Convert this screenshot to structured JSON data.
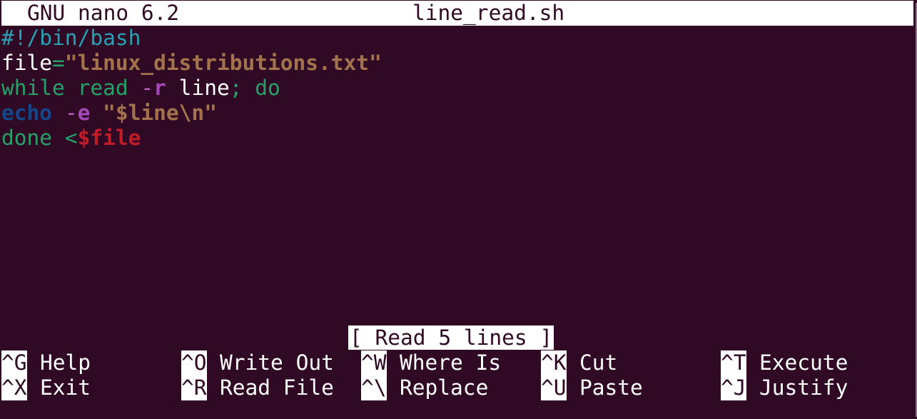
{
  "header": {
    "app_name": "GNU nano 6.2",
    "file_name": "line_read.sh"
  },
  "editor": {
    "lines": [
      {
        "tokens": [
          {
            "text": "#!/bin/bash",
            "kind": "comment"
          }
        ]
      },
      {
        "tokens": [
          {
            "text": "file",
            "kind": "var"
          },
          {
            "text": "=",
            "kind": "op"
          },
          {
            "text": "\"linux_distributions.txt\"",
            "kind": "str"
          }
        ]
      },
      {
        "tokens": [
          {
            "text": "while",
            "kind": "kw"
          },
          {
            "text": " ",
            "kind": "plain"
          },
          {
            "text": "read",
            "kind": "kw"
          },
          {
            "text": " ",
            "kind": "plain"
          },
          {
            "text": "-",
            "kind": "flagdash"
          },
          {
            "text": "r",
            "kind": "flag"
          },
          {
            "text": " line",
            "kind": "plain"
          },
          {
            "text": "; ",
            "kind": "kw"
          },
          {
            "text": "do",
            "kind": "kw"
          }
        ]
      },
      {
        "tokens": [
          {
            "text": "echo",
            "kind": "builtin"
          },
          {
            "text": " ",
            "kind": "plain"
          },
          {
            "text": "-",
            "kind": "flagdash"
          },
          {
            "text": "e",
            "kind": "flag"
          },
          {
            "text": " ",
            "kind": "plain"
          },
          {
            "text": "\"$line\\n\"",
            "kind": "str"
          }
        ]
      },
      {
        "tokens": [
          {
            "text": "done",
            "kind": "kw"
          },
          {
            "text": " <",
            "kind": "kw"
          },
          {
            "text": "$file",
            "kind": "red"
          }
        ]
      }
    ]
  },
  "status_message": "[ Read 5 lines ]",
  "shortcuts": [
    {
      "key": "^G",
      "label": "Help"
    },
    {
      "key": "^X",
      "label": "Exit"
    },
    {
      "key": "^O",
      "label": "Write Out"
    },
    {
      "key": "^R",
      "label": "Read File"
    },
    {
      "key": "^W",
      "label": "Where Is"
    },
    {
      "key": "^\\",
      "label": "Replace"
    },
    {
      "key": "^K",
      "label": "Cut"
    },
    {
      "key": "^U",
      "label": "Paste"
    },
    {
      "key": "^T",
      "label": "Execute"
    },
    {
      "key": "^J",
      "label": "Justify"
    }
  ],
  "colors": {
    "background": "#300a24",
    "foreground": "#ffffff",
    "comment": "#2aa1b3",
    "string": "#a2734c",
    "keyword": "#26a269",
    "builtin": "#12488b",
    "flag": "#a347ba",
    "variable_ref": "#c01c28"
  }
}
